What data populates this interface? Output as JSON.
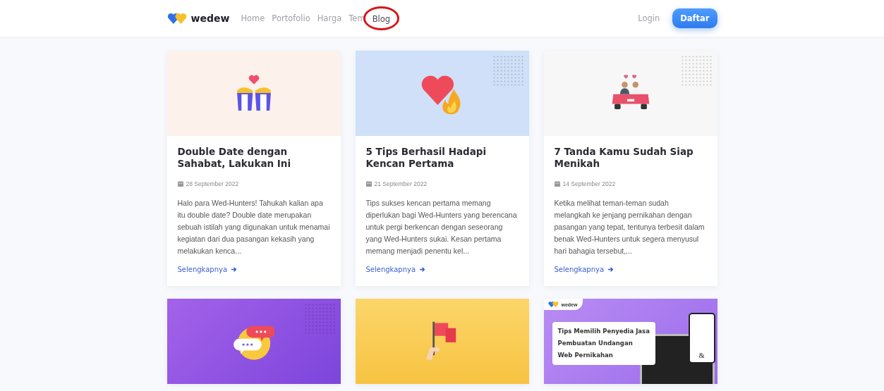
{
  "header": {
    "logo": "wedew",
    "nav": [
      {
        "label": "Home",
        "selected": false,
        "highlighted": false
      },
      {
        "label": "Portofolio",
        "selected": false,
        "highlighted": false
      },
      {
        "label": "Harga",
        "selected": false,
        "highlighted": false
      },
      {
        "label": "Tem",
        "selected": false,
        "highlighted": false
      },
      {
        "label": "Blog",
        "selected": true,
        "highlighted": true
      }
    ],
    "login": "Login",
    "signup": "Daftar"
  },
  "posts": [
    {
      "image": {
        "kind": "popcorn"
      },
      "title": "Double Date dengan Sahabat, Lakukan Ini",
      "date": "28 September 2022",
      "excerpt": "Halo para Wed-Hunters! Tahukah kalian apa itu double date? Double date merupakan sebuah istilah yang digunakan untuk menamai kegiatan dari dua pasangan kekasih yang melakukan kenca...",
      "link": "Selengkapnya"
    },
    {
      "image": {
        "kind": "heart-fire"
      },
      "title": "5 Tips Berhasil Hadapi Kencan Pertama",
      "date": "21 September 2022",
      "excerpt": "Tips sukses kencan pertama memang diperlukan bagi Wed-Hunters yang berencana untuk pergi berkencan dengan seseorang yang Wed-Hunters sukai. Kesan pertama memang menjadi penentu kel...",
      "link": "Selengkapnya"
    },
    {
      "image": {
        "kind": "wedding-car"
      },
      "title": "7 Tanda Kamu Sudah Siap Menikah",
      "date": "14 September 2022",
      "excerpt": "Ketika melihat teman-teman sudah melangkah ke jenjang pernikahan dengan pasangan yang tepat, tentunya terbesit dalam benak Wed-Hunters untuk segera menyusul hari bahagia tersebut,...",
      "link": "Selengkapnya"
    },
    {
      "image": {
        "kind": "chat"
      }
    },
    {
      "image": {
        "kind": "flag"
      }
    },
    {
      "image": {
        "kind": "banner",
        "logo": "wedew",
        "lines": [
          "Tips Memilih Penyedia Jasa",
          "Pembuatan Undangan",
          "Web Pernikahan"
        ],
        "phone_text": "&"
      }
    }
  ]
}
